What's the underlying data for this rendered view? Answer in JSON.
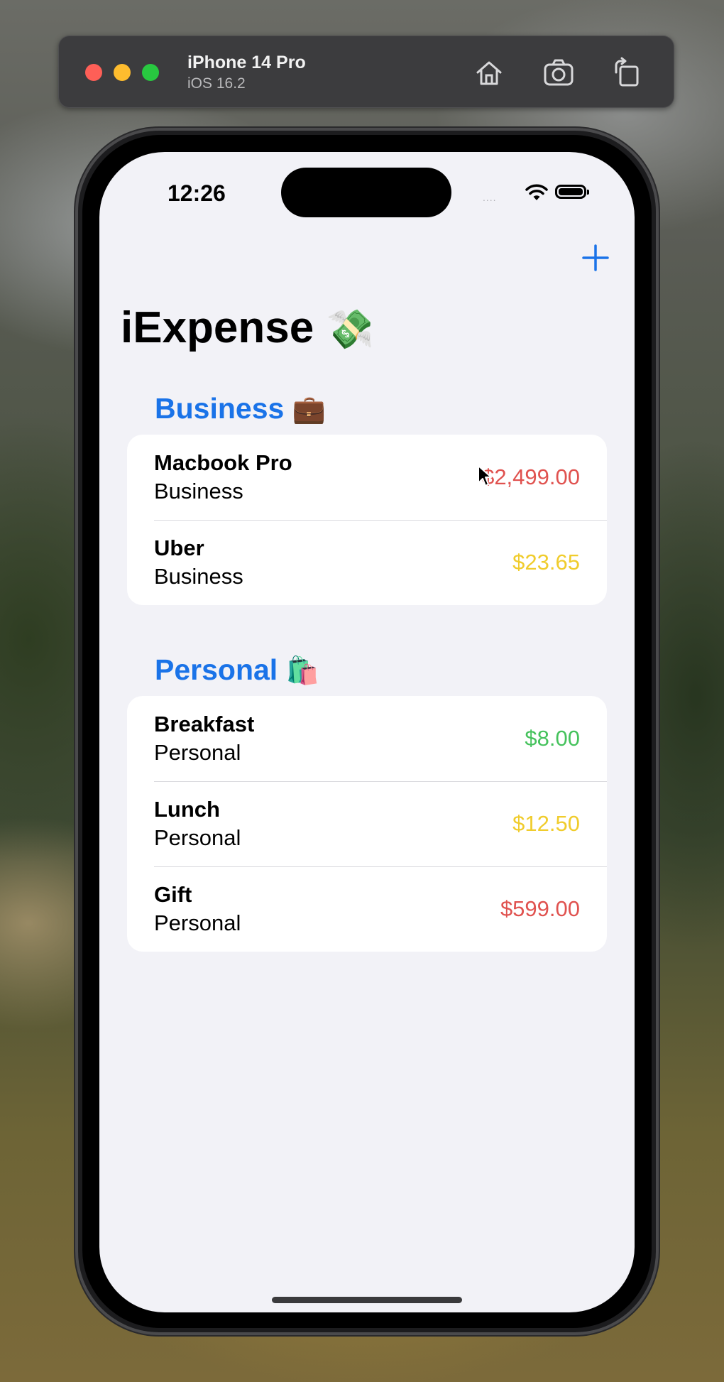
{
  "simulator": {
    "device": "iPhone 14 Pro",
    "os": "iOS 16.2"
  },
  "status_bar": {
    "time": "12:26",
    "signal": "....",
    "wifi_icon": "wifi-icon",
    "battery_icon": "battery-full-icon"
  },
  "nav": {
    "title": "iExpense",
    "title_emoji": "💸",
    "add_button_icon": "plus-icon",
    "accent": "#1a73e8"
  },
  "sections": [
    {
      "title": "Business",
      "emoji": "💼",
      "items": [
        {
          "name": "Macbook Pro",
          "type": "Business",
          "amount": "$2,499.00",
          "color": "#e0524f"
        },
        {
          "name": "Uber",
          "type": "Business",
          "amount": "$23.65",
          "color": "#f0cc2c"
        }
      ]
    },
    {
      "title": "Personal",
      "emoji": "🛍️",
      "items": [
        {
          "name": "Breakfast",
          "type": "Personal",
          "amount": "$8.00",
          "color": "#45c25c"
        },
        {
          "name": "Lunch",
          "type": "Personal",
          "amount": "$12.50",
          "color": "#f0cc2c"
        },
        {
          "name": "Gift",
          "type": "Personal",
          "amount": "$599.00",
          "color": "#e0524f"
        }
      ]
    }
  ]
}
